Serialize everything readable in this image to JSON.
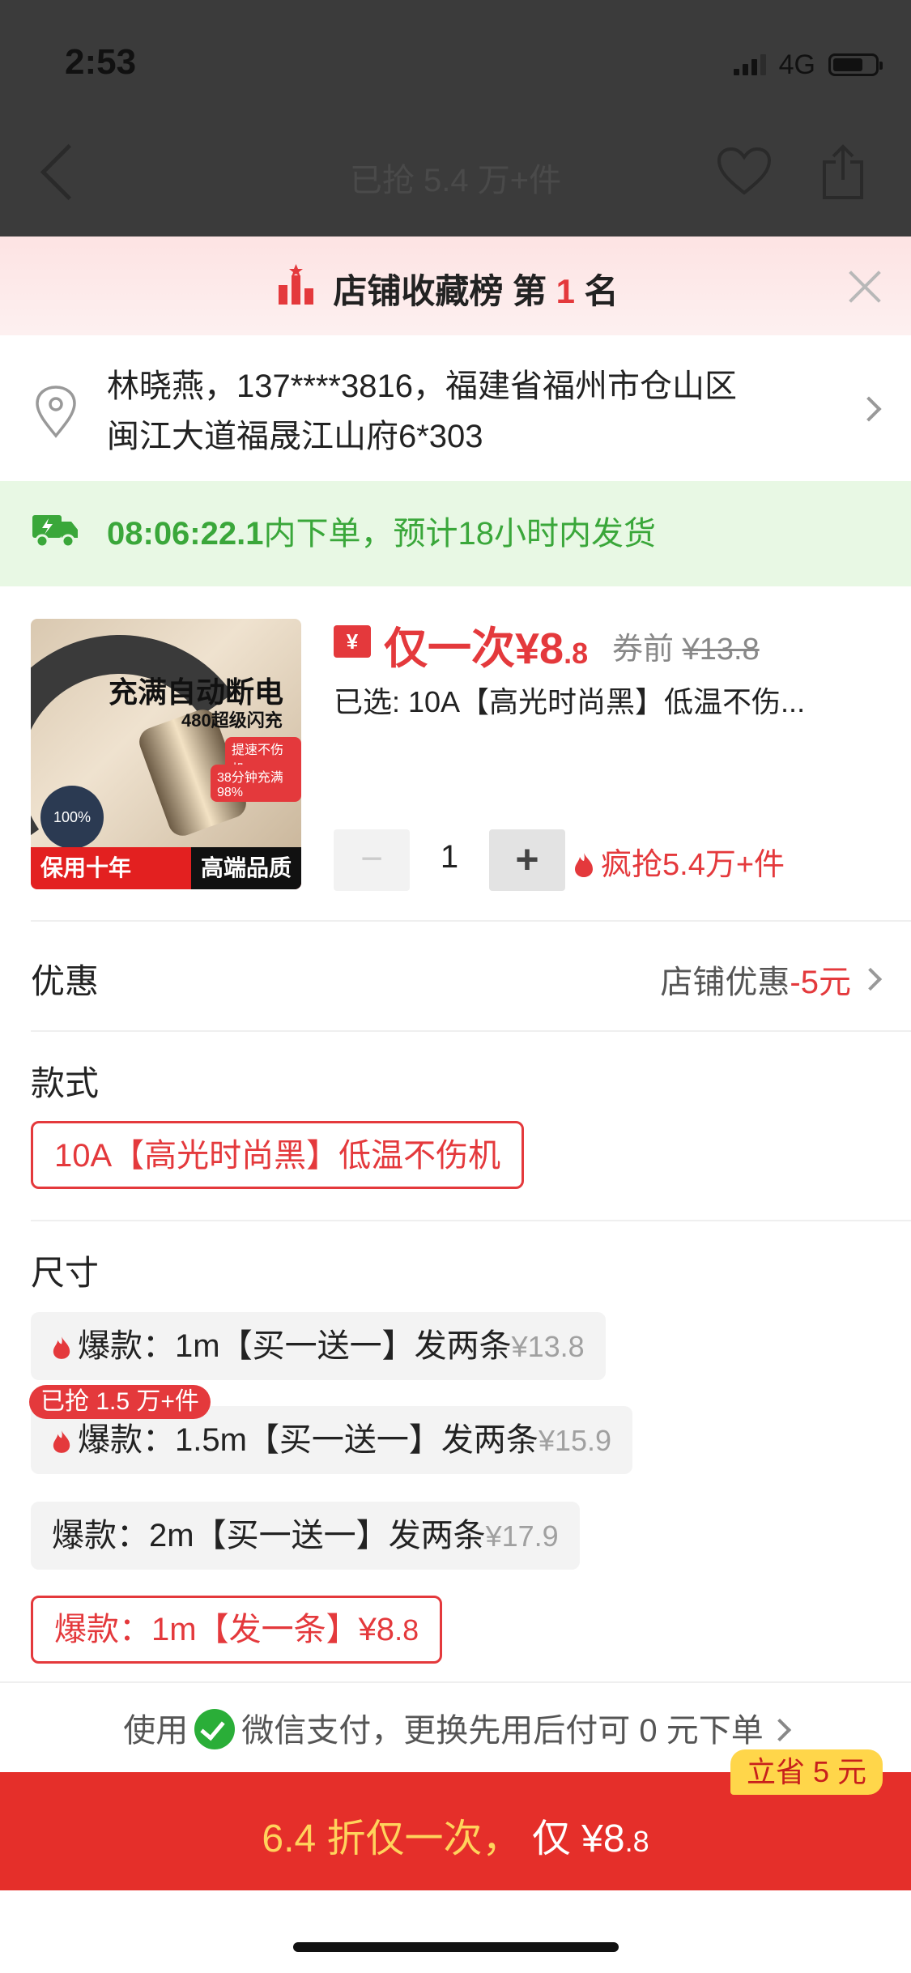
{
  "status_bar": {
    "time": "2:53",
    "network": "4G"
  },
  "nav": {
    "title": "已抢 5.4 万+件"
  },
  "banner": {
    "text_prefix": "店铺收藏榜 第 ",
    "rank": "1",
    "text_suffix": " 名"
  },
  "address": {
    "line1": "林晓燕，137****3816，福建省福州市仓山区",
    "line2": "闽江大道福晟江山府6*303"
  },
  "shipping": {
    "countdown": "08:06:22.1",
    "text": "内下单，预计18小时内发货"
  },
  "product": {
    "image": {
      "title": "充满自动断电",
      "subtitle": "480超级闪充",
      "tag1": "提速不伤机",
      "tag2": "38分钟充满98%",
      "badge": "100%",
      "bottom_left": "保用十年",
      "bottom_right": "高端品质"
    },
    "yen_badge": "¥",
    "price_prefix": "仅一次¥",
    "price_int": "8",
    "price_dec": ".8",
    "orig_label": "券前",
    "orig_price": "¥13.8",
    "selected": "已选: 10A【高光时尚黑】低温不伤..."
  },
  "quantity": {
    "minus": "−",
    "value": "1",
    "plus": "+"
  },
  "hot_sold": "疯抢5.4万+件",
  "promo": {
    "label": "优惠",
    "value_prefix": "店铺优惠",
    "value_amount": "-5元"
  },
  "style_section": {
    "label": "款式",
    "option": "10A【高光时尚黑】低温不伤机"
  },
  "size_section": {
    "label": "尺寸",
    "options": [
      {
        "label": "爆款：1m【买一送一】发两条",
        "price": "¥13.8"
      },
      {
        "label": "爆款：1.5m【买一送一】发两条",
        "price": "¥15.9"
      },
      {
        "label": "爆款：2m【买一送一】发两条",
        "price": "¥17.9"
      },
      {
        "label": "爆款：1m【发一条】¥8",
        "price": ".8"
      }
    ],
    "sold_tag": "已抢 1.5 万+件"
  },
  "payment": {
    "prefix": "使用",
    "text": "微信支付，更换先用后付可 0 元下单"
  },
  "buy": {
    "discount": "6.4 折仅一次，",
    "label": "仅 ¥8",
    "dec": ".8",
    "save_tag": "立省 5 元"
  },
  "colors": {
    "accent": "#e4393c",
    "buy_bar": "#e52f2a",
    "ship_green": "#3aa73a",
    "gold": "#ffd35c"
  }
}
